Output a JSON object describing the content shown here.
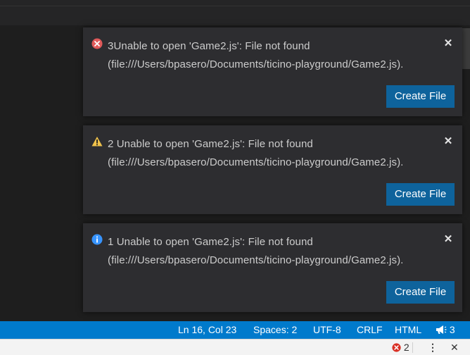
{
  "notifications": [
    {
      "severity": "error",
      "icon": "error-circle-icon",
      "title": "3Unable to open 'Game2.js': File not found",
      "detail": "(file:///Users/bpasero/Documents/ticino-playground/Game2.js).",
      "action_label": "Create File",
      "close_label": "✕"
    },
    {
      "severity": "warning",
      "icon": "warning-triangle-icon",
      "title": "2 Unable to open 'Game2.js': File not found",
      "detail": "(file:///Users/bpasero/Documents/ticino-playground/Game2.js).",
      "action_label": "Create File",
      "close_label": "✕"
    },
    {
      "severity": "info",
      "icon": "info-circle-icon",
      "title": "1 Unable to open 'Game2.js': File not found",
      "detail": "(file:///Users/bpasero/Documents/ticino-playground/Game2.js).",
      "action_label": "Create File",
      "close_label": "✕"
    }
  ],
  "statusbar": {
    "cursor_position": "Ln 16, Col 23",
    "indentation": "Spaces: 2",
    "encoding": "UTF-8",
    "line_ending": "CRLF",
    "language": "HTML",
    "notification_count": "3",
    "background_color": "#007acc"
  },
  "bottombar": {
    "error_count": "2"
  },
  "colors": {
    "error": "#e05a5a",
    "warning": "#f0c24b",
    "info": "#3794ff",
    "button": "#0e639c"
  }
}
